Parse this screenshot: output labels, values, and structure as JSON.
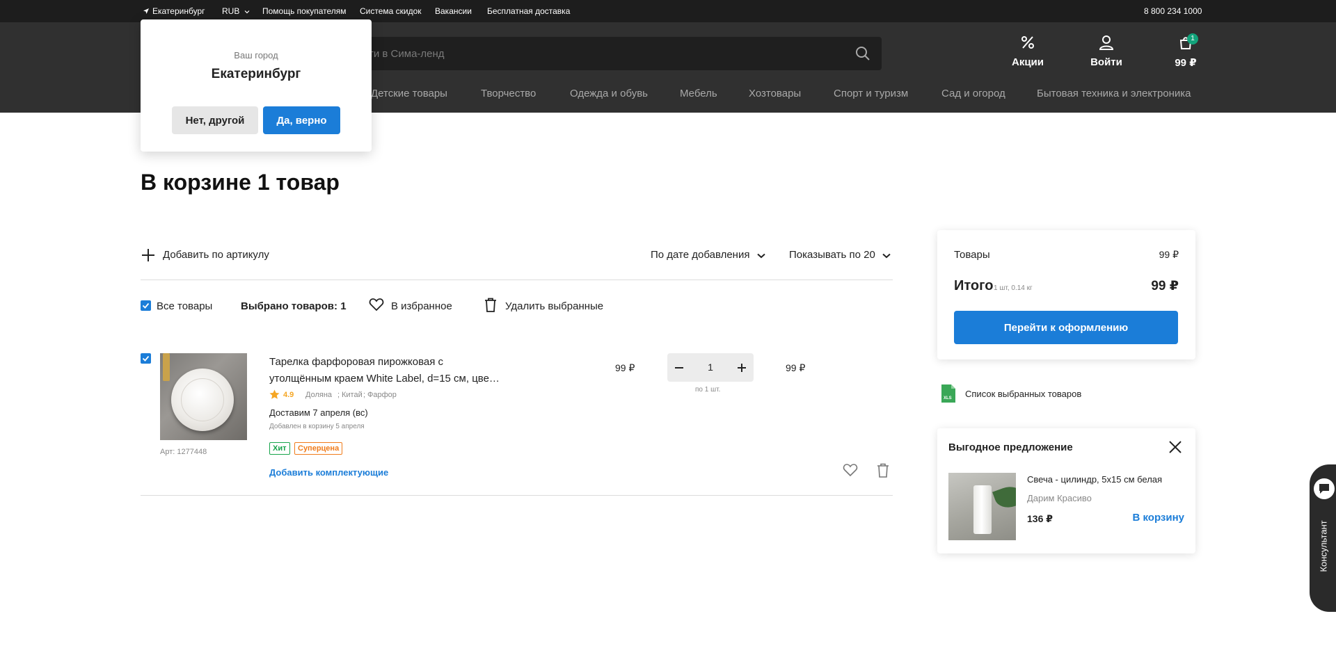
{
  "topbar": {
    "city": "Екатеринбург",
    "currency": "RUB",
    "links": [
      "Помощь покупателям",
      "Система скидок",
      "Вакансии",
      "Бесплатная доставка"
    ],
    "phone": "8 800 234 1000"
  },
  "header": {
    "search_placeholder": "ти в Сима-ленд",
    "actions": {
      "promo_label": "Акции",
      "login_label": "Войти",
      "cart_label": "99 ₽",
      "cart_count": "1"
    },
    "nav": [
      "Детские товары",
      "Творчество",
      "Одежда и обувь",
      "Мебель",
      "Хозтовары",
      "Спорт и туризм",
      "Сад и огород",
      "Бытовая техника и электроника"
    ]
  },
  "city_popup": {
    "question": "Ваш город",
    "city": "Екатеринбург",
    "no_label": "Нет, другой",
    "yes_label": "Да, верно"
  },
  "cart": {
    "title": "В корзине 1 товар",
    "add_by_sku": "Добавить по артикулу",
    "sort_label": "По дате добавления",
    "per_page_label": "Показывать по 20",
    "select_all": "Все товары",
    "selected_count": "Выбрано товаров: 1",
    "to_favorites": "В избранное",
    "delete_selected": "Удалить выбранные",
    "item": {
      "name_line1": "Тарелка фарфоровая пирожковая с",
      "name_line2": "утолщённым краем White Label, d=15 см, цве…",
      "rating": "4.9",
      "brand": "Доляна",
      "country": "Китай",
      "material": "Фарфор",
      "delivery": "Доставим 7 апреля (вс)",
      "added": "Добавлен в корзину 5 апреля",
      "sku": "Арт: 1277448",
      "badge_hit": "Хит",
      "badge_super": "Суперцена",
      "add_accessories": "Добавить комплектующие",
      "price": "99 ₽",
      "quantity": "1",
      "per_unit": "по 1 шт.",
      "total": "99 ₽"
    }
  },
  "summary": {
    "goods_label": "Товары",
    "goods_value": "99 ₽",
    "total_label": "Итого",
    "total_meta": "1 шт, 0.14 кг",
    "total_value": "99 ₽",
    "checkout_label": "Перейти к оформлению",
    "export_label": "Список выбранных товаров",
    "export_icon_text": "XLS"
  },
  "offer": {
    "title": "Выгодное предложение",
    "product_name": "Свеча - цилиндр, 5х15 см белая",
    "seller": "Дарим Красиво",
    "price": "136 ₽",
    "add_label": "В корзину"
  },
  "consultant": {
    "label": "Консультант"
  },
  "colors": {
    "accent": "#1b7dd8",
    "dark_bar": "#1d1d1d",
    "header": "#303030",
    "badge_green": "#12a37b",
    "star": "#f5a623",
    "hit": "#16a34a",
    "super": "#f07b1a"
  }
}
